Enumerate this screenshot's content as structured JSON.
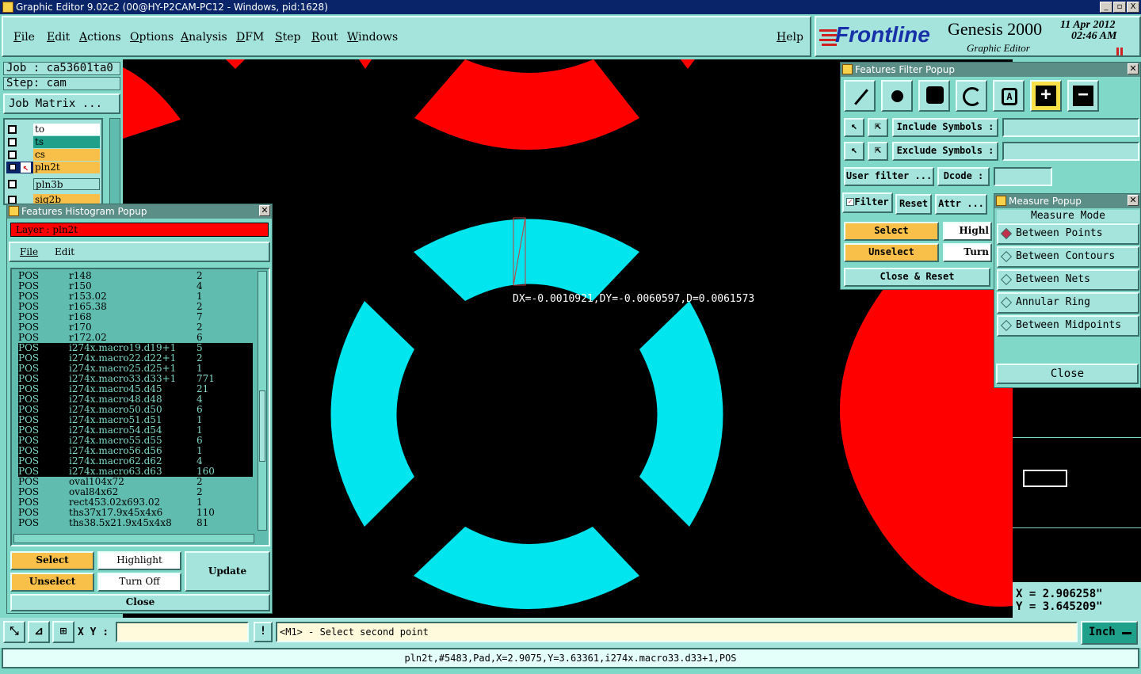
{
  "window": {
    "title": "Graphic Editor 9.02c2 (00@HY-P2CAM-PC12 - Windows, pid:1628)",
    "min_label": "_",
    "max_label": "▫",
    "close_label": "X"
  },
  "menubar": {
    "items": [
      "File",
      "Edit",
      "Actions",
      "Options",
      "Analysis",
      "DFM",
      "Step",
      "Rout",
      "Windows"
    ],
    "help": "Help"
  },
  "logo": {
    "brand": "Frontline",
    "product": "Genesis 2000",
    "subtitle": "Graphic Editor",
    "date": "11 Apr 2012",
    "time": "02:46 AM"
  },
  "left": {
    "job_label": "Job : ca53601ta0",
    "step_label": "Step: cam",
    "job_matrix": "Job Matrix ...",
    "layers": [
      {
        "name": "to",
        "color": "#ffffff"
      },
      {
        "name": "ts",
        "color": "#1fa08a"
      },
      {
        "name": "cs",
        "color": "#f8c048"
      },
      {
        "name": "pln2t",
        "color": "#f8c048"
      },
      {
        "name": "pln3b",
        "color": "#a4e4dc"
      },
      {
        "name": "sig2b",
        "color": "#f8c048"
      }
    ]
  },
  "histogram": {
    "title": "Features Histogram Popup",
    "layer_label": "Layer : pln2t",
    "menu": [
      "File",
      "Edit"
    ],
    "rows": [
      {
        "type": "POS",
        "symbol": "r148",
        "count": "2",
        "sel": false
      },
      {
        "type": "POS",
        "symbol": "r150",
        "count": "4",
        "sel": false
      },
      {
        "type": "POS",
        "symbol": "r153.02",
        "count": "1",
        "sel": false
      },
      {
        "type": "POS",
        "symbol": "r165.38",
        "count": "2",
        "sel": false
      },
      {
        "type": "POS",
        "symbol": "r168",
        "count": "7",
        "sel": false
      },
      {
        "type": "POS",
        "symbol": "r170",
        "count": "2",
        "sel": false
      },
      {
        "type": "POS",
        "symbol": "r172.02",
        "count": "6",
        "sel": false
      },
      {
        "type": "POS",
        "symbol": "i274x.macro19.d19+1",
        "count": "5",
        "sel": true
      },
      {
        "type": "POS",
        "symbol": "i274x.macro22.d22+1",
        "count": "2",
        "sel": true
      },
      {
        "type": "POS",
        "symbol": "i274x.macro25.d25+1",
        "count": "1",
        "sel": true
      },
      {
        "type": "POS",
        "symbol": "i274x.macro33.d33+1",
        "count": "771",
        "sel": true
      },
      {
        "type": "POS",
        "symbol": "i274x.macro45.d45",
        "count": "21",
        "sel": true
      },
      {
        "type": "POS",
        "symbol": "i274x.macro48.d48",
        "count": "4",
        "sel": true
      },
      {
        "type": "POS",
        "symbol": "i274x.macro50.d50",
        "count": "6",
        "sel": true
      },
      {
        "type": "POS",
        "symbol": "i274x.macro51.d51",
        "count": "1",
        "sel": true
      },
      {
        "type": "POS",
        "symbol": "i274x.macro54.d54",
        "count": "1",
        "sel": true
      },
      {
        "type": "POS",
        "symbol": "i274x.macro55.d55",
        "count": "6",
        "sel": true
      },
      {
        "type": "POS",
        "symbol": "i274x.macro56.d56",
        "count": "1",
        "sel": true
      },
      {
        "type": "POS",
        "symbol": "i274x.macro62.d62",
        "count": "4",
        "sel": true
      },
      {
        "type": "POS",
        "symbol": "i274x.macro63.d63",
        "count": "160",
        "sel": true
      },
      {
        "type": "POS",
        "symbol": "oval104x72",
        "count": "2",
        "sel": false
      },
      {
        "type": "POS",
        "symbol": "oval84x62",
        "count": "2",
        "sel": false
      },
      {
        "type": "POS",
        "symbol": "rect453.02x693.02",
        "count": "1",
        "sel": false
      },
      {
        "type": "POS",
        "symbol": "ths37x17.9x45x4x6",
        "count": "110",
        "sel": false
      },
      {
        "type": "POS",
        "symbol": "ths38.5x21.9x45x4x8",
        "count": "81",
        "sel": false
      }
    ],
    "select": "Select",
    "unselect": "Unselect",
    "highlight": "Highlight",
    "turnoff": "Turn Off",
    "update": "Update",
    "close": "Close"
  },
  "filter": {
    "title": "Features Filter Popup",
    "include": "Include Symbols :",
    "exclude": "Exclude Symbols :",
    "user_filter": "User filter ...",
    "dcode": "Dcode :",
    "filter_label": "Filter",
    "reset": "Reset",
    "attr": "Attr ...",
    "select": "Select",
    "unselect": "Unselect",
    "highlight": "Highl",
    "turn": "Turn",
    "close_reset": "Close & Reset",
    "tools": [
      "line-tool-icon",
      "pad-tool-icon",
      "surface-tool-icon",
      "arc-tool-icon",
      "text-tool-icon",
      "positive-icon",
      "negative-icon"
    ]
  },
  "measure": {
    "title": "Measure Popup",
    "mode": "Measure Mode",
    "options": [
      "Between Points",
      "Between Contours",
      "Between Nets",
      "Annular Ring",
      "Between Midpoints"
    ],
    "selected": 0,
    "close": "Close"
  },
  "canvas": {
    "measure_text": "DX=-0.0010921,DY=-0.0060597,D=0.0061573",
    "x_readout": "X  =  2.906258\"",
    "y_readout": "Y  =  3.645209\"",
    "cyan": "#00e5ee",
    "red": "#ff0000"
  },
  "bottom": {
    "xy_label": "X Y :",
    "xy_value": "",
    "prompt": "<M1> - Select second point",
    "units": "Inch",
    "status": "pln2t,#5483,Pad,X=2.9075,Y=3.63361,i274x.macro33.d33+1,POS"
  }
}
